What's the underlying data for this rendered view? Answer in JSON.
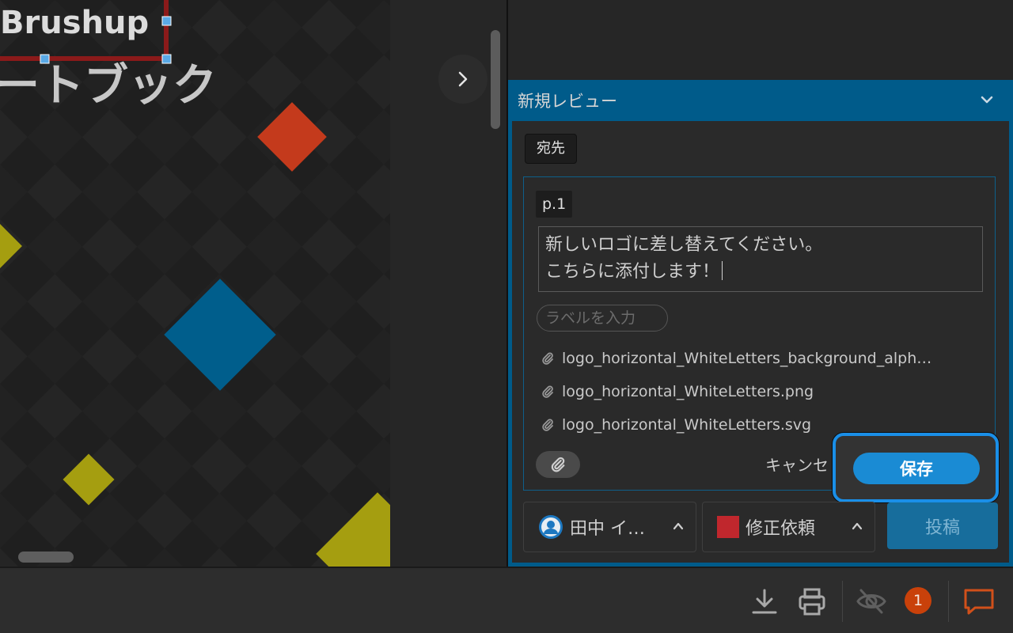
{
  "canvas": {
    "logo_text": "Brushup",
    "subtitle_text": "ートブック"
  },
  "review": {
    "title": "新規レビュー",
    "to_label": "宛先",
    "page_tag": "p.1",
    "comment_text": "新しいロゴに差し替えてください。\nこちらに添付します！",
    "label_placeholder": "ラベルを入力",
    "attachments": [
      "logo_horizontal_WhiteLetters_background_alph…",
      "logo_horizontal_WhiteLetters.png",
      "logo_horizontal_WhiteLetters.svg"
    ],
    "cancel_label": "キャンセ",
    "save_label": "保存",
    "assignee_name": "田中 イ…",
    "status_label": "修正依頼",
    "status_color": "#c0272d",
    "post_label": "投稿"
  },
  "toolbar": {
    "notification_count": "1",
    "icons": [
      "download-icon",
      "print-icon",
      "hide-icon",
      "comment-icon"
    ]
  },
  "colors": {
    "accent": "#1a8bd4",
    "review_header": "#005b8a",
    "badge": "#c9410a"
  }
}
